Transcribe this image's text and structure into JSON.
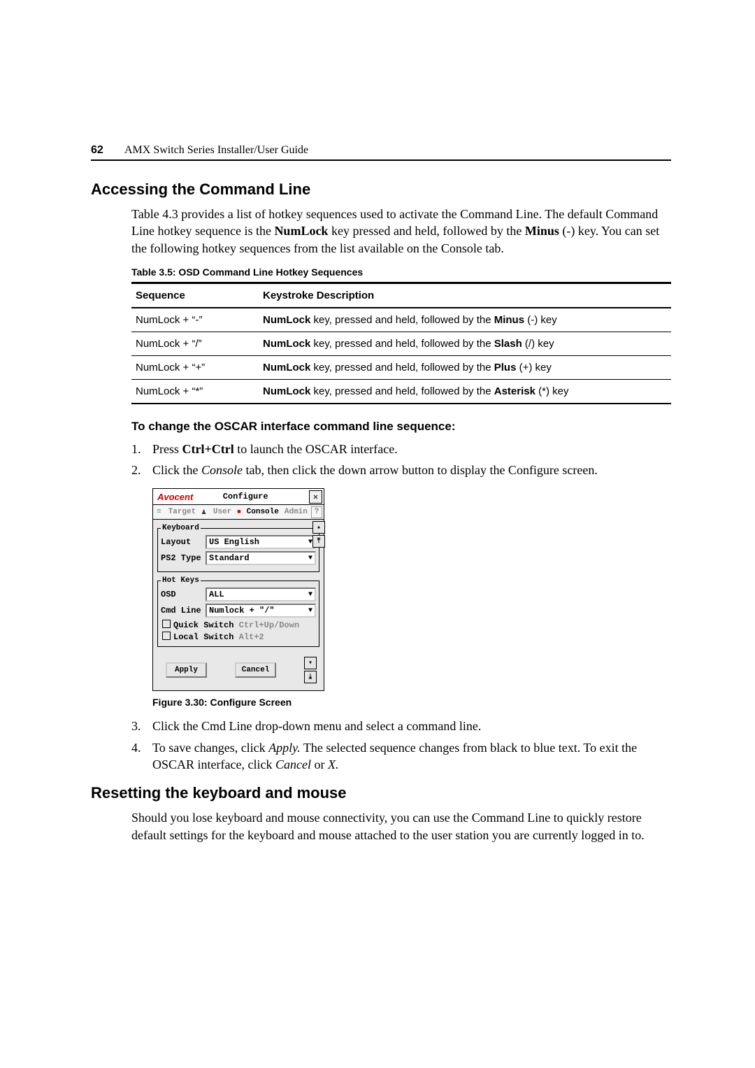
{
  "header": {
    "page_number": "62",
    "guide_title": "AMX Switch Series Installer/User Guide"
  },
  "section1": {
    "heading": "Accessing the Command Line",
    "para1_pre": "Table 4.3 provides a list of hotkey sequences used to activate the Command Line. The default Command Line hotkey sequence is the ",
    "para1_numlock": "NumLock",
    "para1_mid": " key pressed and held, followed by the ",
    "para1_minus": "Minus",
    "para1_sym": " (-) ",
    "para1_post": "key. You can set the following hotkey sequences from the list available on the Console tab.",
    "table_caption": "Table 3.5: OSD Command Line Hotkey Sequences",
    "table": {
      "h1": "Sequence",
      "h2": "Keystroke Description",
      "rows": [
        {
          "seq": "NumLock + “-”",
          "d1": "NumLock",
          "d2": " key, pressed and held, followed by the ",
          "d3": "Minus",
          "d4": " (-) key"
        },
        {
          "seq": "NumLock + “/”",
          "d1": "NumLock",
          "d2": " key, pressed and held, followed by the ",
          "d3": "Slash",
          "d4": " (/) key"
        },
        {
          "seq": "NumLock + “+”",
          "d1": "NumLock",
          "d2": " key, pressed and held, followed by the ",
          "d3": "Plus",
          "d4": " (+) key"
        },
        {
          "seq": "NumLock + “*”",
          "d1": "NumLock",
          "d2": " key, pressed and held, followed by the ",
          "d3": "Asterisk",
          "d4": " (*) key"
        }
      ]
    },
    "subheading": "To change the OSCAR interface command line sequence:",
    "steps12": [
      {
        "pre": "Press ",
        "b": "Ctrl+Ctrl",
        "post": " to launch the OSCAR interface."
      },
      {
        "pre": "Click the ",
        "i": "Console",
        "post": " tab, then click the down arrow button to display the Configure screen."
      }
    ],
    "fig_caption": "Figure 3.30: Configure Screen",
    "steps34": [
      {
        "text": "Click the Cmd Line drop-down menu and select a command line."
      },
      {
        "pre": "To save changes, click ",
        "i1": "Apply.",
        "mid": " The selected sequence changes from black to blue text. To exit the OSCAR interface, click ",
        "i2": "Cancel",
        "mid2": " or ",
        "i3": "X."
      }
    ]
  },
  "oscar": {
    "brand": "Avocent",
    "title": "Configure",
    "tabs": {
      "target": "Target",
      "user": "User",
      "console": "Console",
      "admin": "Admin"
    },
    "kbd_legend": "Keyboard",
    "layout_label": "Layout",
    "layout_value": "US English",
    "ps2_label": "PS2 Type",
    "ps2_value": "Standard",
    "hot_legend": "Hot Keys",
    "osd_label": "OSD",
    "osd_value": "ALL",
    "cmd_label": "Cmd Line",
    "cmd_value": "Numlock + \"/\"",
    "quick_label": "Quick Switch",
    "quick_hint": "Ctrl+Up/Down",
    "local_label": "Local Switch",
    "local_hint": "Alt+2",
    "apply": "Apply",
    "cancel": "Cancel"
  },
  "section2": {
    "heading": "Resetting the keyboard and mouse",
    "para": "Should you lose keyboard and mouse connectivity, you can use the Command Line to quickly restore default settings for the keyboard and mouse attached to the user station you are currently logged in to."
  }
}
